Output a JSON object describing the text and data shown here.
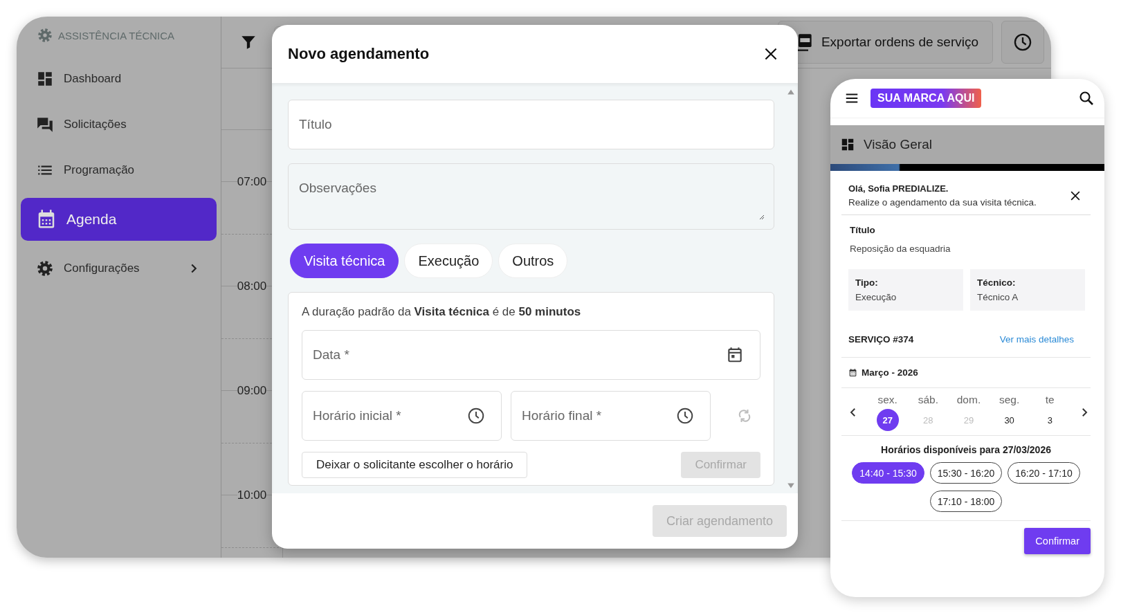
{
  "app": {
    "brand": "ASSISTÊNCIA TÉCNICA",
    "nav": [
      {
        "kind": "dashboard",
        "label": "Dashboard",
        "selected": false,
        "submenu": false
      },
      {
        "kind": "chat",
        "label": "Solicitações",
        "selected": false,
        "submenu": false
      },
      {
        "kind": "list",
        "label": "Programação",
        "selected": false,
        "submenu": false
      },
      {
        "kind": "calendar",
        "label": "Agenda",
        "selected": true,
        "submenu": false
      },
      {
        "kind": "gear",
        "label": "Configurações",
        "selected": false,
        "submenu": true
      }
    ],
    "export_button": "Exportar ordens de serviço",
    "hours": [
      "07:00",
      "08:00",
      "09:00",
      "10:00"
    ]
  },
  "modal": {
    "title": "Novo agendamento",
    "title_placeholder": "Título",
    "notes_placeholder": "Observações",
    "types": [
      {
        "label": "Visita técnica",
        "selected": true
      },
      {
        "label": "Execução",
        "selected": false
      },
      {
        "label": "Outros",
        "selected": false
      }
    ],
    "duration_note": "A duração padrão da **Visita técnica** é de **50 minutos**",
    "date_placeholder": "Data *",
    "start_placeholder": "Horário inicial *",
    "end_placeholder": "Horário final *",
    "requester_button": "Deixar o solicitante escolher o horário",
    "confirm_button": {
      "label": "Confirmar",
      "disabled": true
    },
    "create_button": {
      "label": "Criar agendamento",
      "disabled": true
    }
  },
  "mobile": {
    "brand": "SUA MARCA AQUI",
    "page_title": "Visão Geral",
    "greeting": "Olá, Sofia PREDIALIZE.",
    "message": "Realize o agendamento da sua visita técnica.",
    "title_label": "Título",
    "title_value": "Reposição da esquadria",
    "info": [
      {
        "label": "Tipo:",
        "value": "Execução"
      },
      {
        "label": "Técnico:",
        "value": "Técnico A"
      }
    ],
    "service": "SERVIÇO #374",
    "details_link": "Ver mais detalhes",
    "month": "Março - 2026",
    "days": [
      {
        "weekday": "sex.",
        "day": "27",
        "selected": true,
        "disabled": false
      },
      {
        "weekday": "sáb.",
        "day": "28",
        "selected": false,
        "disabled": true
      },
      {
        "weekday": "dom.",
        "day": "29",
        "selected": false,
        "disabled": true
      },
      {
        "weekday": "seg.",
        "day": "30",
        "selected": false,
        "disabled": false
      },
      {
        "weekday": "te",
        "day": "3",
        "selected": false,
        "disabled": false
      }
    ],
    "slots_title": "Horários disponíveis para 27/03/2026",
    "slots": [
      {
        "label": "14:40 - 15:30",
        "selected": true
      },
      {
        "label": "15:30 - 16:20",
        "selected": false
      },
      {
        "label": "16:20 - 17:10",
        "selected": false
      },
      {
        "label": "17:10 - 18:00",
        "selected": false
      }
    ],
    "confirm_button": "Confirmar"
  }
}
